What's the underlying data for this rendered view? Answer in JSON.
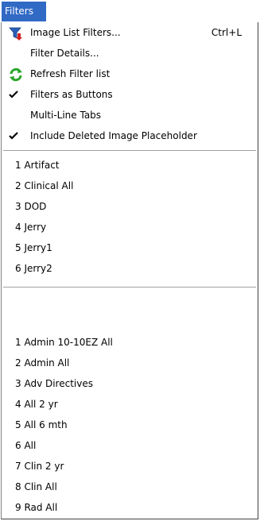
{
  "menu_title": "Filters",
  "actions": [
    {
      "label": "Image List Filters...",
      "shortcut": "Ctrl+L",
      "icon": "funnel-icon"
    },
    {
      "label": "Filter Details...",
      "shortcut": ""
    },
    {
      "label": "Refresh Filter list",
      "icon": "refresh-icon"
    },
    {
      "label": "Filters as Buttons",
      "checked": true
    },
    {
      "label": "Multi-Line Tabs",
      "checked": false
    },
    {
      "label": "Include Deleted Image Placeholder",
      "checked": true
    }
  ],
  "user_filters": [
    "1 Artifact",
    "2 Clinical All",
    "3 DOD",
    "4 Jerry",
    "5 Jerry1",
    "6 Jerry2"
  ],
  "shared_filters": [
    "1 Admin 10-10EZ All",
    "2 Admin All",
    "3 Adv Directives",
    "4 All 2 yr",
    "5 All 6 mth",
    "6 All",
    "7 Clin 2 yr",
    "8 Clin All",
    "9 Rad All"
  ],
  "colors": {
    "highlight": "#316ac5",
    "funnel": "#2b5fb8",
    "arrow_red": "#d42020",
    "refresh_green": "#2aa52a"
  }
}
